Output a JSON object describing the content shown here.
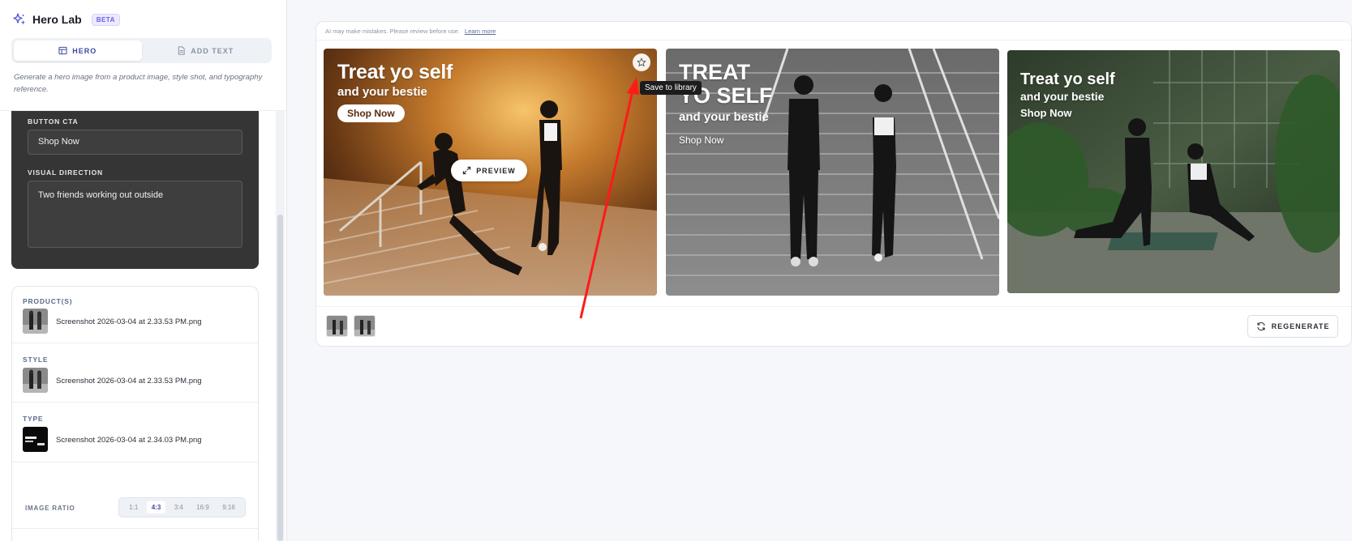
{
  "app": {
    "title": "Hero Lab",
    "badge": "BETA"
  },
  "tabs": [
    {
      "label": "HERO",
      "icon": "layout-icon",
      "active": true
    },
    {
      "label": "ADD TEXT",
      "icon": "document-icon",
      "active": false
    }
  ],
  "description": "Generate a hero image from a product image, style shot, and typography reference.",
  "form": {
    "button_cta_label": "BUTTON CTA",
    "button_cta_value": "Shop Now",
    "visual_direction_label": "VISUAL DIRECTION",
    "visual_direction_value": "Two friends working out outside"
  },
  "references": [
    {
      "label": "PRODUCT(S)",
      "file": "Screenshot 2026-03-04 at 2.33.53 PM.png"
    },
    {
      "label": "STYLE",
      "file": "Screenshot 2026-03-04 at 2.33.53 PM.png"
    },
    {
      "label": "TYPE",
      "file": "Screenshot 2026-03-04 at 2.34.03 PM.png"
    }
  ],
  "image_ratio": {
    "label": "IMAGE RATIO",
    "options": [
      "1:1",
      "4:3",
      "3:4",
      "16:9",
      "9:16"
    ],
    "selected": "4:3"
  },
  "disclaimer": {
    "text": "AI may make mistakes. Please review before use.",
    "link": "Learn more"
  },
  "images": [
    {
      "headline": "Treat yo self",
      "subline": "and your bestie",
      "cta": "Shop Now"
    },
    {
      "headline_line1": "TREAT",
      "headline_line2": "YO SELF",
      "subline": "and your bestie",
      "cta": "Shop Now"
    },
    {
      "headline": "Treat yo self",
      "subline": "and your bestie",
      "cta": "Shop Now"
    }
  ],
  "preview_label": "PREVIEW",
  "tooltip": "Save to library",
  "regenerate_label": "REGENERATE",
  "colors": {
    "accent": "#4f5bd5",
    "annotation": "#ff1a1a",
    "dark_card": "#353535"
  }
}
